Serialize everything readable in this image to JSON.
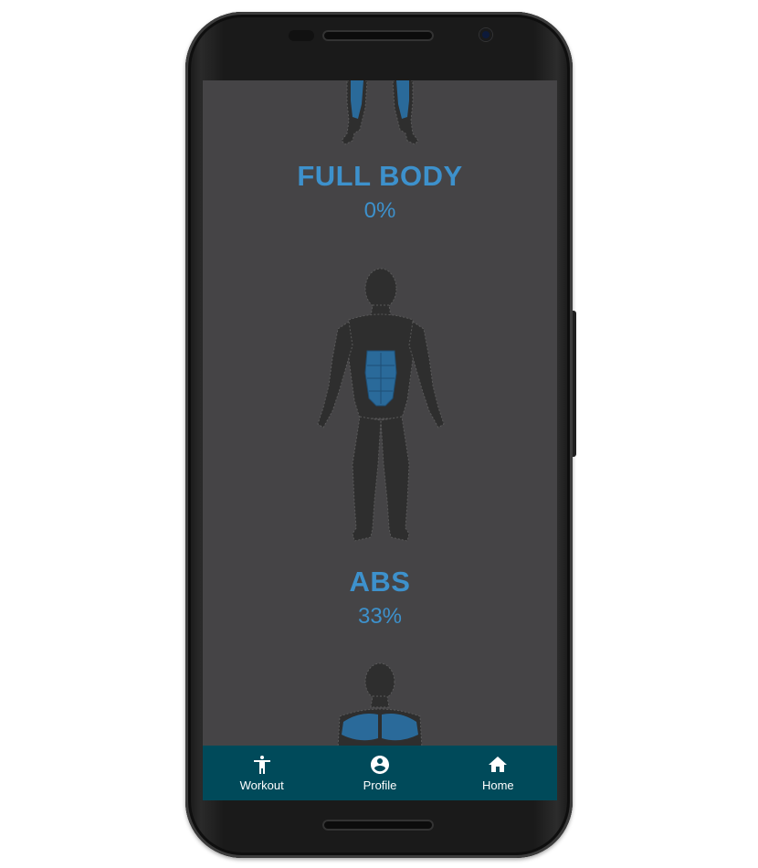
{
  "screen": {
    "background": "#454446",
    "accent": "#3d91cc",
    "cards": [
      {
        "name": "FULL BODY",
        "progress": "0%"
      },
      {
        "name": "ABS",
        "progress": "33%"
      }
    ],
    "figures": [
      {
        "id": "legs-figure",
        "highlight": "legs"
      },
      {
        "id": "abs-figure",
        "highlight": "abs"
      },
      {
        "id": "chest-figure",
        "highlight": "chest"
      }
    ]
  },
  "bottom_nav": {
    "background": "#004a5a",
    "items": [
      {
        "label": "Workout",
        "icon": "person-standing-icon"
      },
      {
        "label": "Profile",
        "icon": "account-circle-icon"
      },
      {
        "label": "Home",
        "icon": "home-icon"
      }
    ]
  }
}
